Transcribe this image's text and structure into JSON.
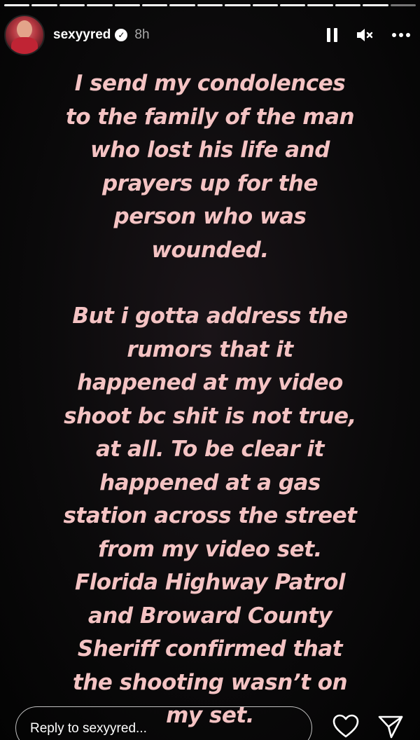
{
  "story": {
    "progress_segments": 15,
    "current_segment": 14,
    "header": {
      "username": "sexyyred",
      "time": "8h"
    },
    "message_lines_1": [
      "I send my condolences",
      "to the family of the man",
      "who lost his life and",
      "prayers up for the",
      "person who was",
      "wounded."
    ],
    "message_lines_2": [
      "But i gotta address the",
      "rumors that it",
      "happened at my video",
      "shoot bc shit is not true,",
      "at all.  To be clear it",
      "happened at a gas",
      "station across the street",
      "from my video set.",
      "Florida Highway Patrol",
      "and Broward County",
      "Sheriff confirmed that",
      "the shooting wasn’t on",
      "my set."
    ],
    "reply_placeholder": "Reply to sexyyred...",
    "colors": {
      "text": "#f4c3c3",
      "background": "#0b0a0b"
    }
  }
}
